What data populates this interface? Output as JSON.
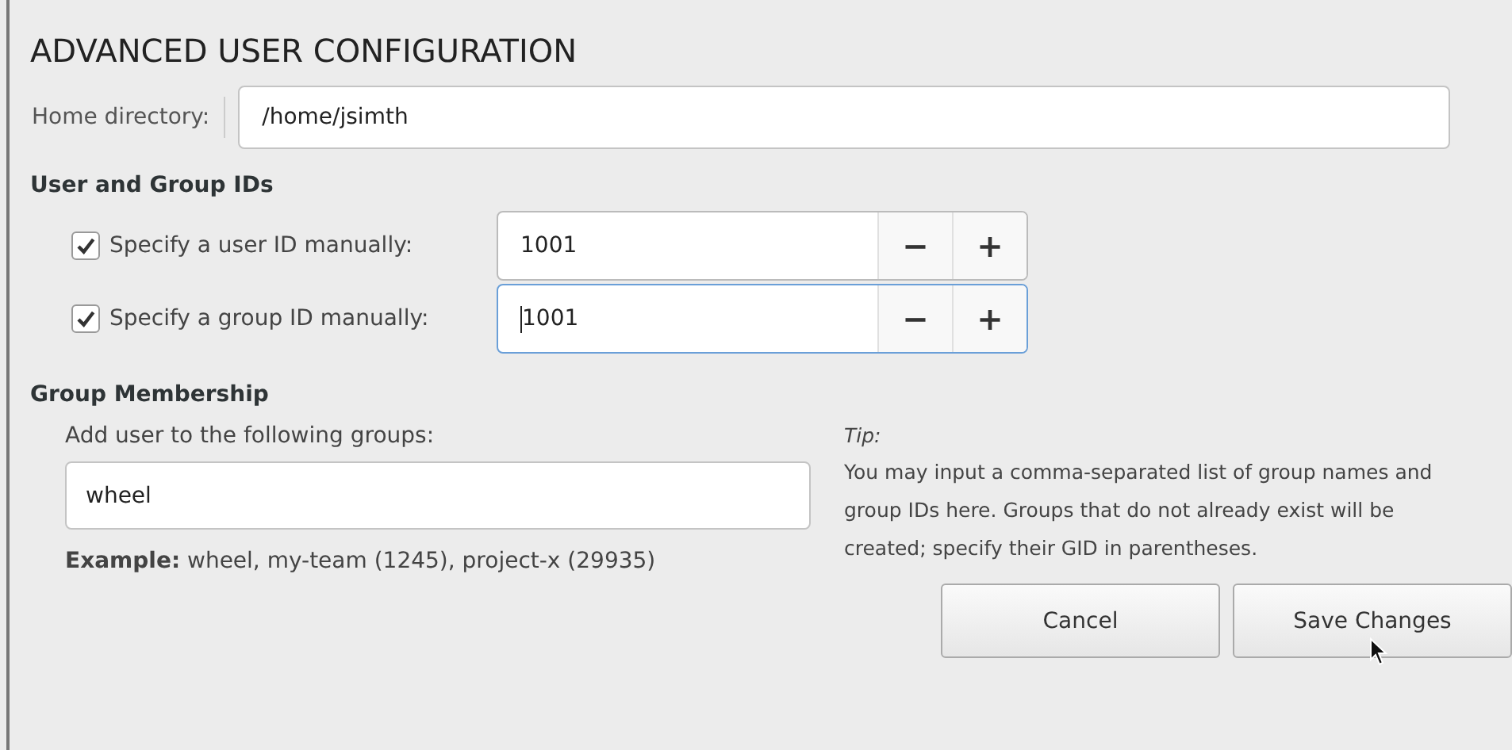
{
  "title": "ADVANCED USER CONFIGURATION",
  "home": {
    "label": "Home directory:",
    "value": "/home/jsimth"
  },
  "ids": {
    "heading": "User and Group IDs",
    "rows": [
      {
        "label": "Specify a user ID manually:",
        "checked": true,
        "value": "1001",
        "focused": false,
        "minus": "−",
        "plus": "+"
      },
      {
        "label": "Specify a group ID manually:",
        "checked": true,
        "value": "1001",
        "focused": true,
        "minus": "−",
        "plus": "+"
      }
    ]
  },
  "membership": {
    "heading": "Group Membership",
    "label": "Add user to the following groups:",
    "value": "wheel",
    "example": "**Example:** wheel, my-team (1245), project-x (29935)",
    "tip_title": "Tip:",
    "tip": "You may input a comma-separated list of group names and group IDs here. Groups that do not already exist will be created; specify their GID in parentheses."
  },
  "buttons": [
    "Cancel",
    "Save Changes"
  ]
}
